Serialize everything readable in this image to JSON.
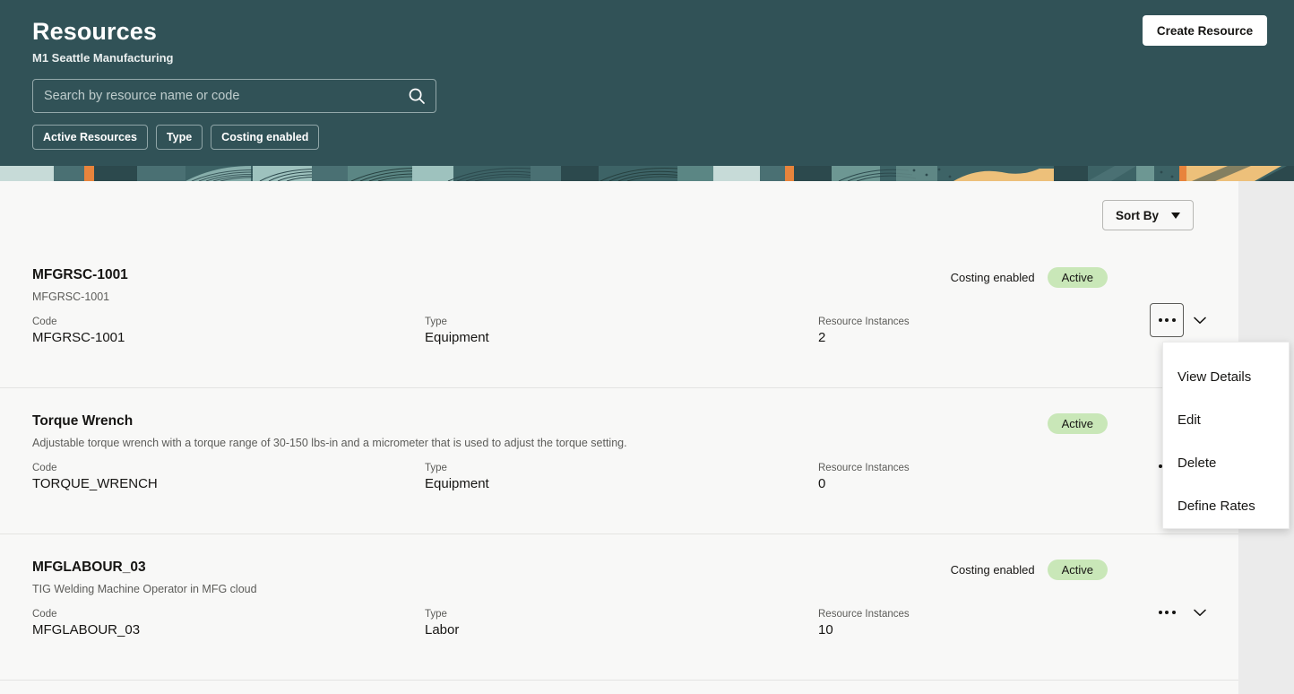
{
  "theme": {
    "header_bg": "#315257",
    "panel_bg": "#f8f8f7",
    "page_bg": "#ebebeb",
    "badge_bg": "#c9e7b8",
    "accent_orange": "#e8843c",
    "banner_sand": "#edc07a",
    "banner_pale": "#c7dbd8"
  },
  "header": {
    "title": "Resources",
    "subtitle": "M1 Seattle Manufacturing",
    "create_button": "Create Resource",
    "search": {
      "placeholder": "Search by resource name or code",
      "value": "",
      "icon": "search-icon"
    },
    "filters": [
      {
        "label": "Active Resources"
      },
      {
        "label": "Type"
      },
      {
        "label": "Costing enabled"
      }
    ]
  },
  "toolbar": {
    "sort_by_label": "Sort By",
    "sort_icon": "chevron-down-icon"
  },
  "labels": {
    "code": "Code",
    "type": "Type",
    "instances": "Resource Instances",
    "costing_enabled": "Costing enabled"
  },
  "rows": [
    {
      "name": "MFGRSC-1001",
      "description": "MFGRSC-1001",
      "code": "MFGRSC-1001",
      "type": "Equipment",
      "instances": "2",
      "costing_enabled": "Costing enabled",
      "status": "Active",
      "menu_open": true
    },
    {
      "name": "Torque Wrench",
      "description": "Adjustable torque wrench with a torque range of 30-150 lbs-in and a micrometer that is used to adjust the torque setting.",
      "code": "TORQUE_WRENCH",
      "type": "Equipment",
      "instances": "0",
      "costing_enabled": "",
      "status": "Active",
      "menu_open": false
    },
    {
      "name": "MFGLABOUR_03",
      "description": "TIG Welding Machine Operator in MFG cloud",
      "code": "MFGLABOUR_03",
      "type": "Labor",
      "instances": "10",
      "costing_enabled": "Costing enabled",
      "status": "Active",
      "menu_open": false
    }
  ],
  "context_menu": {
    "items": [
      {
        "label": "View Details"
      },
      {
        "label": "Edit"
      },
      {
        "label": "Delete"
      },
      {
        "label": "Define Rates"
      }
    ]
  }
}
